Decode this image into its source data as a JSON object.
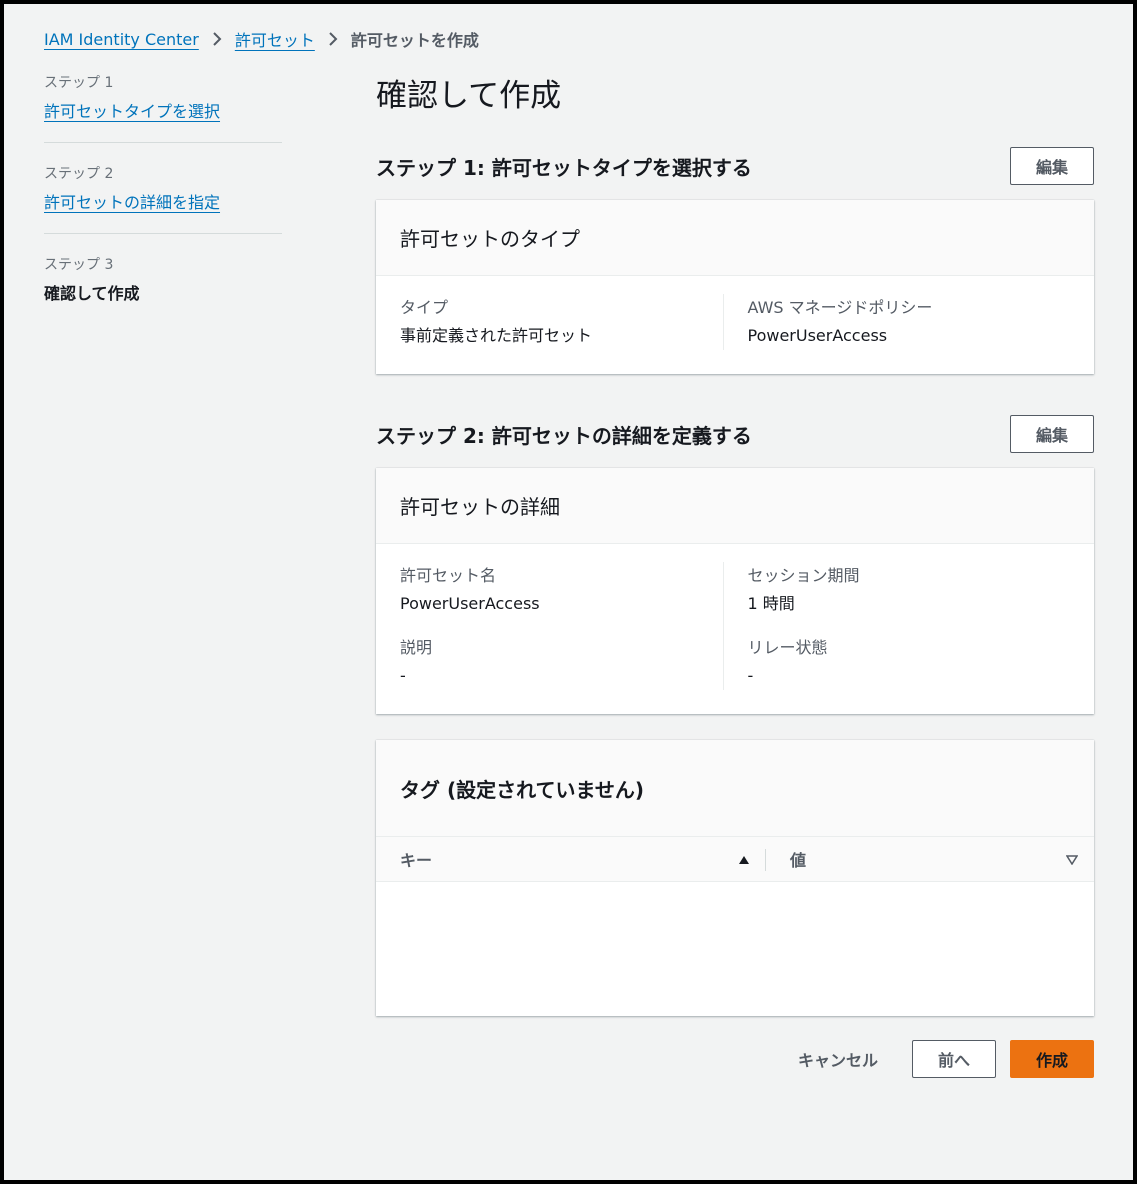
{
  "breadcrumb": {
    "items": [
      "IAM Identity Center",
      "許可セット"
    ],
    "current": "許可セットを作成"
  },
  "steps": [
    {
      "label": "ステップ 1",
      "title": "許可セットタイプを選択"
    },
    {
      "label": "ステップ 2",
      "title": "許可セットの詳細を指定"
    },
    {
      "label": "ステップ 3",
      "title": "確認して作成"
    }
  ],
  "page_title": "確認して作成",
  "section1": {
    "title": "ステップ 1: 許可セットタイプを選択する",
    "edit_label": "編集",
    "card_title": "許可セットのタイプ",
    "type_key": "タイプ",
    "type_value": "事前定義された許可セット",
    "policy_key": "AWS マネージドポリシー",
    "policy_value": "PowerUserAccess"
  },
  "section2": {
    "title": "ステップ 2: 許可セットの詳細を定義する",
    "edit_label": "編集",
    "card_title": "許可セットの詳細",
    "name_key": "許可セット名",
    "name_value": "PowerUserAccess",
    "session_key": "セッション期間",
    "session_value": "1 時間",
    "desc_key": "説明",
    "desc_value": "-",
    "relay_key": "リレー状態",
    "relay_value": "-"
  },
  "tags": {
    "title": "タグ (設定されていません)",
    "columns": [
      "キー",
      "値"
    ]
  },
  "footer": {
    "cancel": "キャンセル",
    "previous": "前へ",
    "create": "作成"
  },
  "colors": {
    "link": "#0073bb",
    "primary": "#ec7211",
    "background": "#f2f3f3"
  }
}
